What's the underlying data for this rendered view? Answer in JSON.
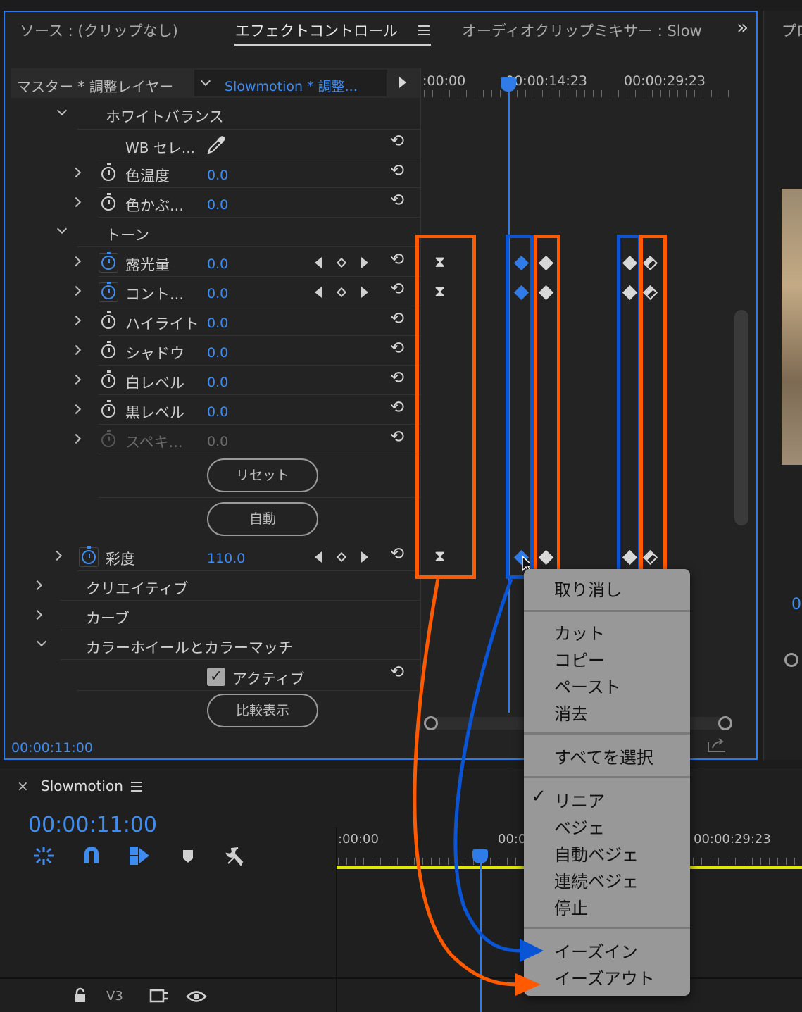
{
  "tabs": {
    "source": "ソース : (クリップなし)",
    "effect_controls": "エフェクトコントロール",
    "audio_mixer": "オーディオクリップミキサー : Slow",
    "program": "プロ",
    "overflow": "»"
  },
  "clip_header": {
    "master": "マスター * 調整レイヤー",
    "sequence": "Slowmotion * 調整..."
  },
  "ruler": {
    "t0": ":00:00",
    "t1": "00:00:14:23",
    "t2": "00:00:29:23"
  },
  "sections": {
    "white_balance": "ホワイトバランス",
    "tone": "トーン",
    "creative": "クリエイティブ",
    "curves": "カーブ",
    "color_wheels": "カラーホイールとカラーマッチ"
  },
  "params": {
    "wb_select": "WB セレ...",
    "temperature": {
      "label": "色温度",
      "value": "0.0"
    },
    "tint": {
      "label": "色かぶ...",
      "value": "0.0"
    },
    "exposure": {
      "label": "露光量",
      "value": "0.0"
    },
    "contrast": {
      "label": "コント...",
      "value": "0.0"
    },
    "highlights": {
      "label": "ハイライト",
      "value": "0.0"
    },
    "shadows": {
      "label": "シャドウ",
      "value": "0.0"
    },
    "whites": {
      "label": "白レベル",
      "value": "0.0"
    },
    "blacks": {
      "label": "黒レベル",
      "value": "0.0"
    },
    "specular": {
      "label": "スペキ...",
      "value": "0.0"
    },
    "saturation": {
      "label": "彩度",
      "value": "110.0"
    },
    "active": "アクティブ"
  },
  "buttons": {
    "reset": "リセット",
    "auto": "自動",
    "compare": "比較表示"
  },
  "panel_timecode": "00:00:11:00",
  "context_menu": {
    "undo": "取り消し",
    "cut": "カット",
    "copy": "コピー",
    "paste": "ペースト",
    "clear": "消去",
    "select_all": "すべてを選択",
    "linear": "リニア",
    "checkmark": "✓",
    "bezier": "ベジェ",
    "auto_bezier": "自動ベジェ",
    "continuous_bezier": "連続ベジェ",
    "hold": "停止",
    "ease_in": "イーズイン",
    "ease_out": "イーズアウト"
  },
  "timeline": {
    "close": "×",
    "name": "Slowmotion",
    "timecode": "00:00:11:00",
    "t0": ":00:00",
    "t1": "00:0",
    "t2": "00:00:29:23",
    "track": "V3"
  },
  "program_value": "0",
  "colors": {
    "accent_blue": "#3f8cf0",
    "highlight_orange": "#ff5a00",
    "highlight_blue": "#0a55d6",
    "work_area_yellow": "#e4e600"
  }
}
